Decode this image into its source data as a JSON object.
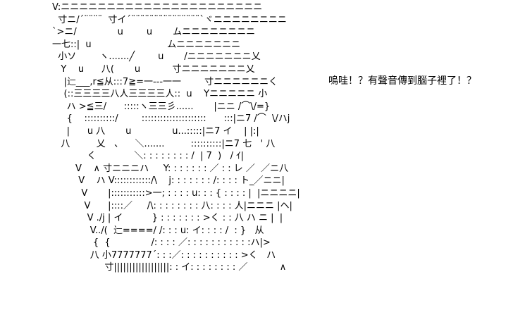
{
  "ascii_art": {
    "lines": [
      "V:ニニニニニニニニニニニニニニニニニニニニニニ",
      "  寸ニ/´¨¨¨¨  寸イ´¨¨¨¨¨¨¨¨¨¨¨¨¨¨¨`ヾニニニニニニニニ",
      "`>ニ/              u        u       ムニニニニニニニニ",
      "一七::|  u                          ムニニニニニニニ",
      "  小ソ        ヽ.......╱        u       /ニニニニニニニ乂",
      "   Y    u      八(       u           寸ニニニニニニニ乂",
      "    |辷___,r≦从:::7≧=一-‐-一一        寸ニニニニニニく",
      "    (::三三三三八人三三三三人::  u    Yニニニニニ 小",
      "     ハ >≦三/      :::::ヽ三三彡......       |ニニ /⌒\\/=}",
      "     {    ::::::::::/        :::::::::::::::::::::      :::|ニ7 /⌒  \\/ハj",
      "     |      u 八       u              u...:::::|ニ7 イ    | |:|",
      "   八         乂   、    ＼.......         ::::::::::|ニ7 七   ' 八",
      "            く             ＼: : : : : : : : /  | 7  )   / ｲ|",
      "        V    ∧ 寸ニニニハ     Y: : : : : : : ／ : : レ ／  ／ニ八",
      "         V    ハ V::::::::::::/\\    j: : : : : : : /: : : : ト_／ニニ|",
      "          V       |:::::::::::>一; : : : : u: : : { : : : : |  |ニニニニ|",
      "           V      |::::／     /\\: : : : : : : : 八: : : : 人|ニニニ |ヘ|",
      "            V ./j | イ          } : : : : : : : >く : : 八 ハ ニ |  |",
      "             V../(  辷====/ /: : : u: イ: : : : /  : }   从",
      "              {  {              /: : : : ／: : : : : : : : : : :ハ|>",
      "             八 小7777777´: : :／: : : : : : : : : : >く   ハ",
      "                  寸||||||||||||||||||: : イ: : : : : : : : ／           ∧"
    ]
  },
  "caption": {
    "text": "嗚哇！？有聲音傳到腦子裡了！？"
  }
}
